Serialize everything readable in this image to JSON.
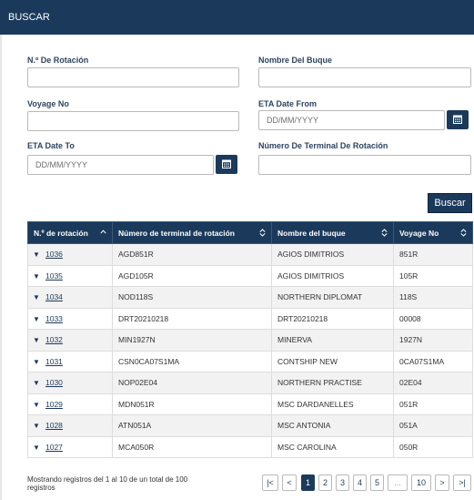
{
  "header": {
    "title": "BUSCAR"
  },
  "form": {
    "rotation_no_label": "N.º De Rotación",
    "ship_name_label": "Nombre Del Buque",
    "voyage_no_label": "Voyage No",
    "eta_from_label": "ETA Date From",
    "eta_from_placeholder": "DD/MM/YYYY",
    "eta_to_label": "ETA Date To",
    "eta_to_placeholder": "DD/MM/YYYY",
    "terminal_rotation_label": "Número De Terminal De Rotación",
    "search_label": "Buscar"
  },
  "icons": {
    "calendar": "calendar-icon",
    "sort": "sort-icon",
    "sort_up": "sort-ascending-icon",
    "row_toggle": "caret-down-icon"
  },
  "colors": {
    "brand": "#1b3a5b",
    "row_alt": "#f2f2f2"
  },
  "table": {
    "columns": [
      "N.º de rotación",
      "Número de terminal de rotación",
      "Nombre del buque",
      "Voyage No"
    ],
    "rows": [
      [
        "1036",
        "AGD851R",
        "AGIOS DIMITRIOS",
        "851R"
      ],
      [
        "1035",
        "AGD105R",
        "AGIOS DIMITRIOS",
        "105R"
      ],
      [
        "1034",
        "NOD118S",
        "NORTHERN DIPLOMAT",
        "118S"
      ],
      [
        "1033",
        "DRT20210218",
        "DRT20210218",
        "00008"
      ],
      [
        "1032",
        "MIN1927N",
        "MINERVA",
        "1927N"
      ],
      [
        "1031",
        "CSN0CA07S1MA",
        "CONTSHIP NEW",
        "0CA07S1MA"
      ],
      [
        "1030",
        "NOP02E04",
        "NORTHERN PRACTISE",
        "02E04"
      ],
      [
        "1029",
        "MDN051R",
        "MSC DARDANELLES",
        "051R"
      ],
      [
        "1028",
        "ATN051A",
        "MSC ANTONIA",
        "051A"
      ],
      [
        "1027",
        "MCA050R",
        "MSC CAROLINA",
        "050R"
      ]
    ]
  },
  "footer": {
    "info": "Mostrando registros del 1 al 10 de un total de 100 registros",
    "pagination": {
      "first": "|<",
      "prev": "<",
      "pages": [
        "1",
        "2",
        "3",
        "4",
        "5"
      ],
      "ellipsis": "...",
      "last_page": "10",
      "next": ">",
      "last": ">|",
      "current": "1"
    }
  }
}
